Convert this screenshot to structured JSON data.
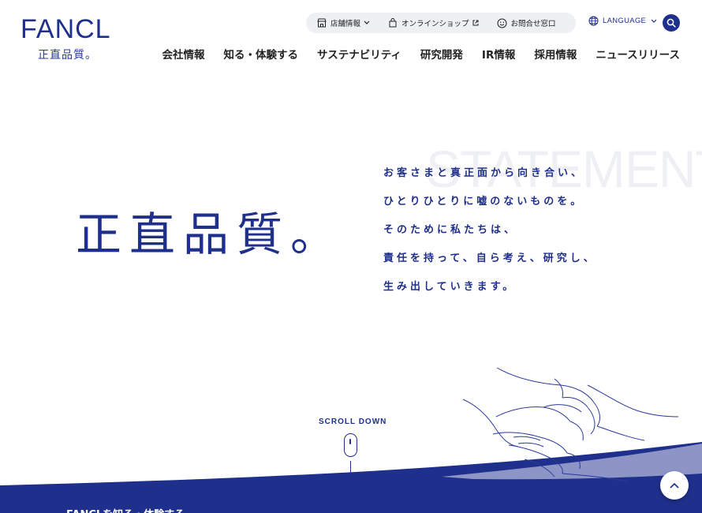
{
  "brand": {
    "logo_text": "FANCL",
    "tagline": "正直品質。"
  },
  "utility": {
    "items": [
      {
        "label": "店舗情報",
        "icon": "store-icon",
        "after_icon": "chevron-down-icon"
      },
      {
        "label": "オンラインショップ",
        "icon": "shopping-bag-icon",
        "after_icon": "external-link-icon"
      },
      {
        "label": "お問合せ窓口",
        "icon": "smiley-icon"
      }
    ],
    "language": {
      "label": "LANGUAGE",
      "icon": "globe-icon"
    },
    "search": {
      "icon": "search-icon"
    }
  },
  "nav": {
    "items": [
      "会社情報",
      "知る・体験する",
      "サステナビリティ",
      "研究開発",
      "IR情報",
      "採用情報",
      "ニュースリリース"
    ]
  },
  "hero": {
    "title": "正直品質。",
    "watermark": "STATEMENT",
    "statement_lines": [
      "お客さまと真正面から向き合い、",
      "ひとりひとりに嘘のないものを。",
      "そのために私たちは、",
      "責任を持って、自ら考え、研究し、",
      "生み出していきます。"
    ]
  },
  "scroll": {
    "label": "SCROLL DOWN",
    "icon": "mouse-icon"
  },
  "section_peek": {
    "title": "FANCLを知る・体験する"
  },
  "back_to_top": {
    "icon": "chevron-up-icon"
  },
  "colors": {
    "brand_blue": "#1f2f8c",
    "pill_bg": "#eef0f3",
    "text_dark": "#222222",
    "white": "#ffffff"
  }
}
